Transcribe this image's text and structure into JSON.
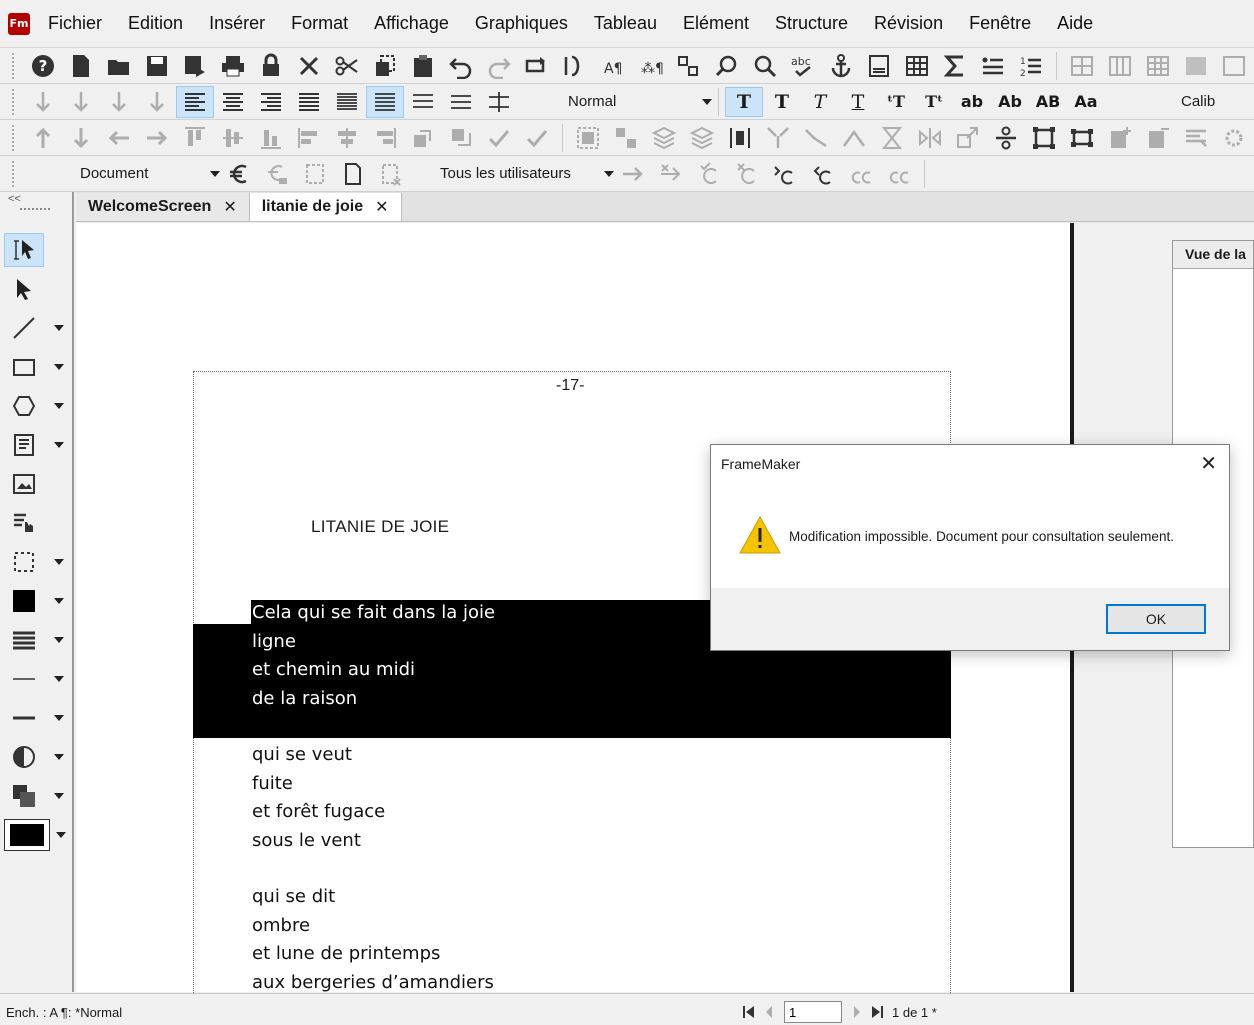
{
  "app": {
    "logo_text": "Fm"
  },
  "menubar": {
    "items": [
      "Fichier",
      "Edition",
      "Insérer",
      "Format",
      "Affichage",
      "Graphiques",
      "Tableau",
      "Elément",
      "Structure",
      "Révision",
      "Fenêtre",
      "Aide"
    ]
  },
  "toolbar2": {
    "paragraph_style": "Normal",
    "char_buttons": [
      "T",
      "T",
      "T",
      "T",
      "ᵗT",
      "Tᵗ",
      "ab",
      "Ab",
      "AB",
      "Aa"
    ],
    "font": "Calib"
  },
  "toolbar4": {
    "scope": "Document",
    "users": "Tous les utilisateurs"
  },
  "tools": {
    "collapse_label": "<<"
  },
  "tabs": [
    {
      "label": "WelcomeScreen",
      "close": "✕"
    },
    {
      "label": "litanie de joie",
      "close": "✕"
    }
  ],
  "right_panel": {
    "title": "Vue de la"
  },
  "document": {
    "page_number": "-17-",
    "title": "LITANIE DE JOIE",
    "stanza1": [
      "Cela qui se fait dans la joie",
      "ligne",
      "et chemin au midi",
      "de la raison"
    ],
    "stanza2": [
      "qui se veut",
      "fuite",
      "et forêt fugace",
      "sous le vent"
    ],
    "stanza3": [
      "qui se dit",
      "ombre",
      "et lune de printemps",
      "aux bergeries d’amandiers"
    ]
  },
  "dialog": {
    "title": "FrameMaker",
    "close": "✕",
    "message": "Modification impossible. Document pour consultation seulement.",
    "ok_label": "OK"
  },
  "statusbar": {
    "text": "Ench. : A  ¶: *Normal",
    "page_input": "1",
    "page_count": "1 de 1 *"
  },
  "colors": {
    "accent": "#0078d7",
    "selection": "#cce4f7",
    "highlight": "#000000",
    "logo": "#b30000"
  }
}
